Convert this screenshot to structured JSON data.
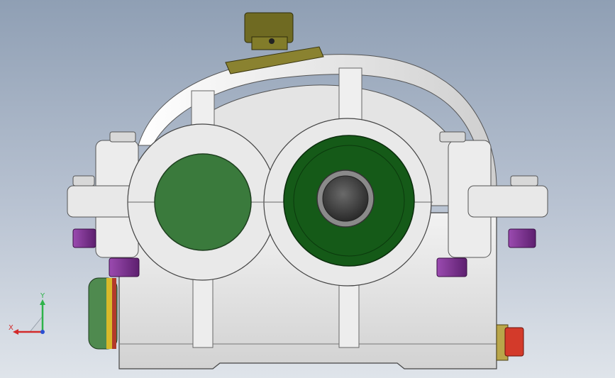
{
  "viewport": {
    "background_top": "#8f9fb4",
    "background_bottom": "#dfe4ea"
  },
  "triad": {
    "x_label": "X",
    "y_label": "Y",
    "x_color": "#d22a2a",
    "y_color": "#2eb34a",
    "z_color": "#2a4fd2"
  },
  "model": {
    "housing_color": "#e6e6e6",
    "shaft_left_color": "#3a7a3c",
    "shaft_right_color": "#155a18",
    "bolt_color": "#7a2d8f",
    "breather_color": "#6f6a22",
    "drain_plug_color": "#d33a2a",
    "icons": [
      "gearbox-housing",
      "input-shaft-seat",
      "output-shaft-seat",
      "breather-cap",
      "oil-level-gauge",
      "drain-plug",
      "cap-bolt"
    ]
  }
}
